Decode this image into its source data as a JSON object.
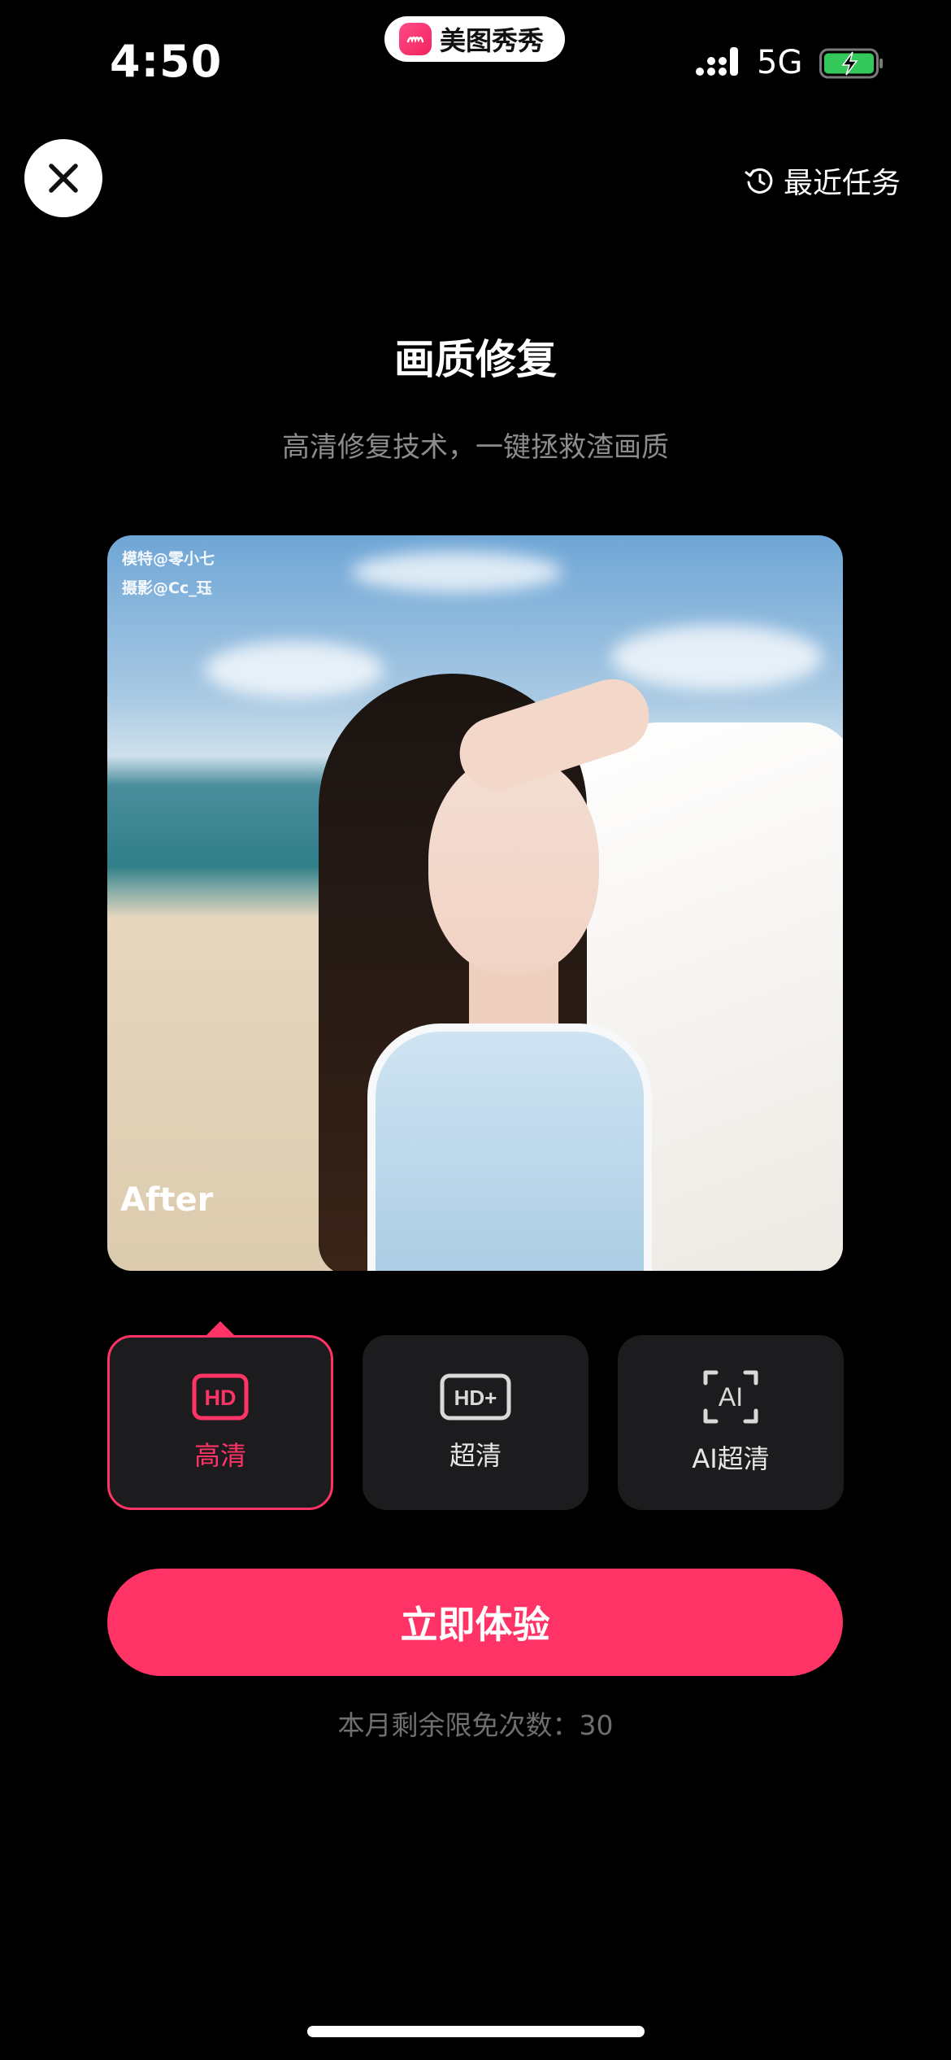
{
  "status_bar": {
    "time": "4:50",
    "app_name": "美图秀秀",
    "network": "5G",
    "battery_state": "charging",
    "colors": {
      "battery": "#34c759"
    }
  },
  "nav": {
    "close_icon": "close-icon",
    "recent_tasks_label": "最近任务",
    "recent_tasks_icon": "history-icon"
  },
  "header": {
    "title": "画质修复",
    "subtitle": "高清修复技术，一键拯救渣画质"
  },
  "preview": {
    "credit_model": "模特@零小七",
    "credit_photo": "摄影@Cc_珏",
    "state_label": "After"
  },
  "options": [
    {
      "label": "高清",
      "icon": "hd-icon",
      "selected": true
    },
    {
      "label": "超清",
      "icon": "hd-plus-icon",
      "selected": false
    },
    {
      "label": "AI超清",
      "icon": "ai-icon",
      "selected": false
    }
  ],
  "cta": {
    "label": "立即体验",
    "quota_text": "本月剩余限免次数：30"
  },
  "colors": {
    "accent": "#ff3366",
    "background": "#000000",
    "card": "#1c1c1e",
    "muted_text": "#8c8c8c"
  }
}
